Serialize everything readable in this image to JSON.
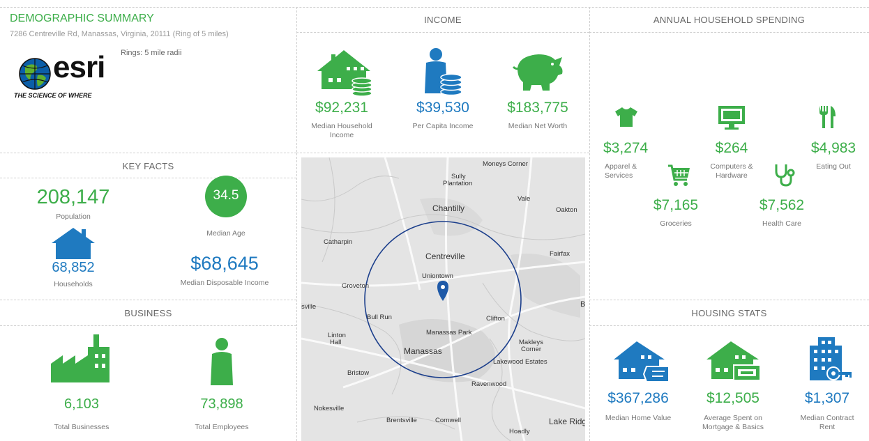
{
  "demo": {
    "title": "DEMOGRAPHIC SUMMARY",
    "address": "7286 Centreville Rd, Manassas, Virginia, 20111 (Ring of 5 miles)",
    "rings": "Rings: 5 mile radii",
    "logo_text": "esri",
    "logo_tagline": "THE SCIENCE OF WHERE"
  },
  "income": {
    "title": "INCOME",
    "items": [
      {
        "value": "$92,231",
        "label1": "Median Household",
        "label2": "Income"
      },
      {
        "value": "$39,530",
        "label1": "Per Capita Income",
        "label2": ""
      },
      {
        "value": "$183,775",
        "label1": "Median Net Worth",
        "label2": ""
      }
    ]
  },
  "spending": {
    "title": "ANNUAL HOUSEHOLD SPENDING",
    "items": [
      {
        "value": "$3,274",
        "label1": "Apparel &",
        "label2": "Services"
      },
      {
        "value": "$264",
        "label1": "Computers &",
        "label2": "Hardware"
      },
      {
        "value": "$4,983",
        "label1": "Eating Out",
        "label2": ""
      },
      {
        "value": "$7,165",
        "label1": "Groceries",
        "label2": ""
      },
      {
        "value": "$7,562",
        "label1": "Health Care",
        "label2": ""
      }
    ]
  },
  "keyfacts": {
    "title": "KEY FACTS",
    "population": "208,147",
    "population_label": "Population",
    "median_age": "34.5",
    "median_age_label": "Median Age",
    "households": "68,852",
    "households_label": "Households",
    "disposable_income": "$68,645",
    "disposable_income_label": "Median Disposable Income"
  },
  "business": {
    "title": "BUSINESS",
    "total_businesses": "6,103",
    "total_businesses_label": "Total Businesses",
    "total_employees": "73,898",
    "total_employees_label": "Total Employees"
  },
  "housing": {
    "title": "HOUSING STATS",
    "items": [
      {
        "value": "$367,286",
        "label1": "Median Home Value",
        "label2": ""
      },
      {
        "value": "$12,505",
        "label1": "Average Spent on",
        "label2": "Mortgage & Basics"
      },
      {
        "value": "$1,307",
        "label1": "Median Contract",
        "label2": "Rent"
      }
    ]
  },
  "map": {
    "places": [
      "Moneys Corner",
      "Sully",
      "Plantation",
      "Vale",
      "Chantilly",
      "Oakton",
      "Catharpin",
      "Fairfax",
      "Centreville",
      "Uniontown",
      "Groveton",
      "sville",
      "Bull Run",
      "Clifton",
      "Manassas Park",
      "Linton",
      "Hall",
      "Manassas",
      "Makleys",
      "Corner",
      "Lakewood Estates",
      "Bristow",
      "Ravenwood",
      "Nokesville",
      "Brentsville",
      "Cornwell",
      "Lake Ridg",
      "Hoadly",
      "B"
    ]
  },
  "colors": {
    "green": "#3dae4a",
    "blue": "#1f7ac0",
    "ring": "#1c3f8c"
  }
}
